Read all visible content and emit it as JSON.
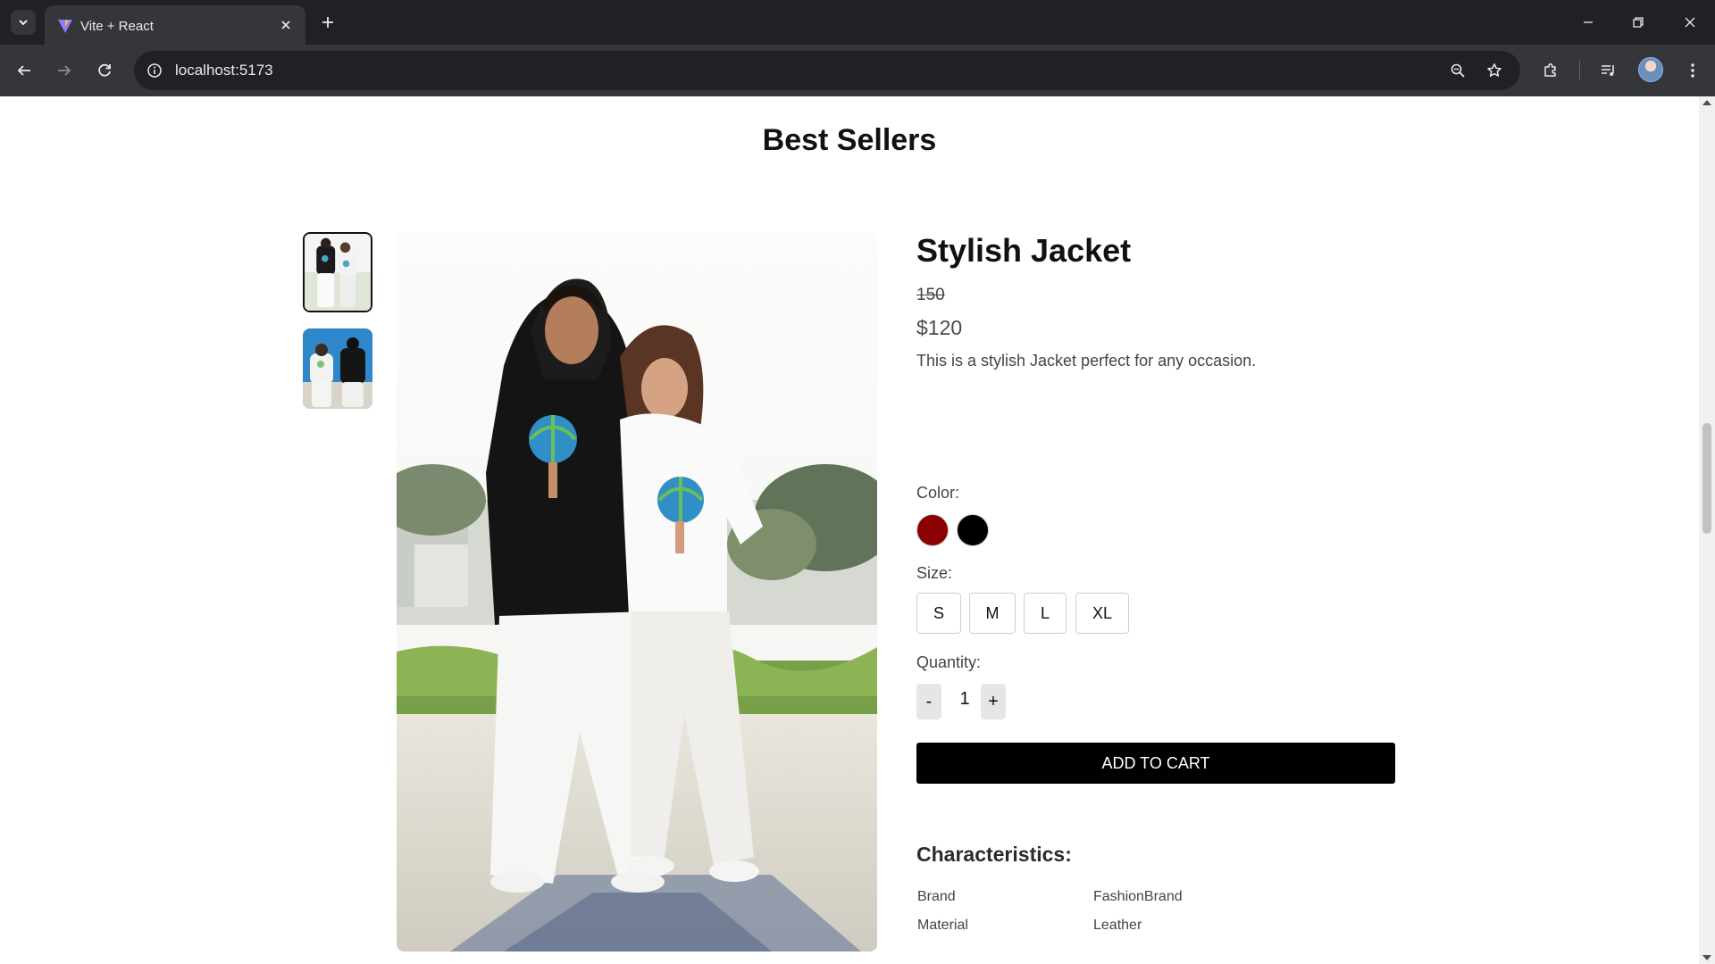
{
  "browser": {
    "tab_title": "Vite + React",
    "url": "localhost:5173",
    "icons": {
      "tab_list": "chevron-down-icon",
      "favicon": "vite-logo-icon",
      "tab_close": "close-icon",
      "new_tab": "plus-icon",
      "minimize": "minimize-icon",
      "restore": "restore-icon",
      "close_window": "close-icon",
      "back": "arrow-left-icon",
      "forward": "arrow-right-icon",
      "reload": "reload-icon",
      "site_info": "info-icon",
      "zoom": "zoom-icon",
      "bookmark": "star-icon",
      "extensions": "puzzle-icon",
      "media": "media-control-icon",
      "profile": "avatar",
      "menu": "kebab-menu-icon"
    }
  },
  "page": {
    "section_title": "Best Sellers",
    "product": {
      "title": "Stylish Jacket",
      "original_price": "150",
      "price": "$120",
      "description": "This is a stylish Jacket perfect for any occasion.",
      "color_label": "Color:",
      "colors": [
        {
          "name": "dark red",
          "hex": "#8b0000"
        },
        {
          "name": "black",
          "hex": "#000000"
        }
      ],
      "size_label": "Size:",
      "sizes": [
        "S",
        "M",
        "L",
        "XL"
      ],
      "quantity_label": "Quantity:",
      "quantity": "1",
      "decrement_label": "-",
      "increment_label": "+",
      "add_to_cart_label": "ADD TO CART",
      "characteristics_title": "Characteristics:",
      "characteristics": [
        {
          "key": "Brand",
          "value": "FashionBrand"
        },
        {
          "key": "Material",
          "value": "Leather"
        }
      ]
    }
  }
}
